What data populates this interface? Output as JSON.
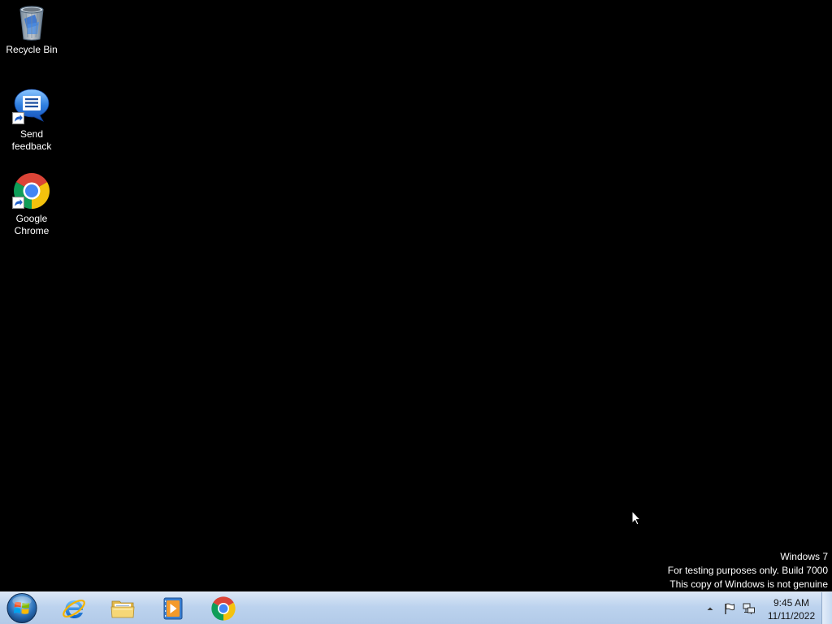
{
  "desktop": {
    "background": "#000000",
    "icons": [
      {
        "label": "Recycle Bin",
        "icon": "recycle-bin-icon",
        "shortcut": false
      },
      {
        "label": "Send feedback",
        "icon": "send-feedback-icon",
        "shortcut": true
      },
      {
        "label": "Google Chrome",
        "icon": "google-chrome-icon",
        "shortcut": true
      }
    ]
  },
  "watermark": {
    "lines": [
      "Windows 7",
      "For testing purposes only. Build 7000",
      "This copy of Windows is not genuine"
    ]
  },
  "cursor": {
    "icon": "arrow-cursor-icon"
  },
  "taskbar": {
    "color": "#bcd3ee",
    "start_button": {
      "icon": "windows-start-orb-icon"
    },
    "pinned": [
      {
        "icon": "internet-explorer-icon"
      },
      {
        "icon": "windows-explorer-icon"
      },
      {
        "icon": "windows-media-player-icon"
      },
      {
        "icon": "google-chrome-icon"
      }
    ],
    "tray": {
      "icons": [
        {
          "icon": "show-hidden-icons-arrow-icon"
        },
        {
          "icon": "action-center-flag-icon"
        },
        {
          "icon": "network-icon"
        }
      ],
      "clock": {
        "time": "9:45 AM",
        "date": "11/11/2022"
      }
    }
  }
}
